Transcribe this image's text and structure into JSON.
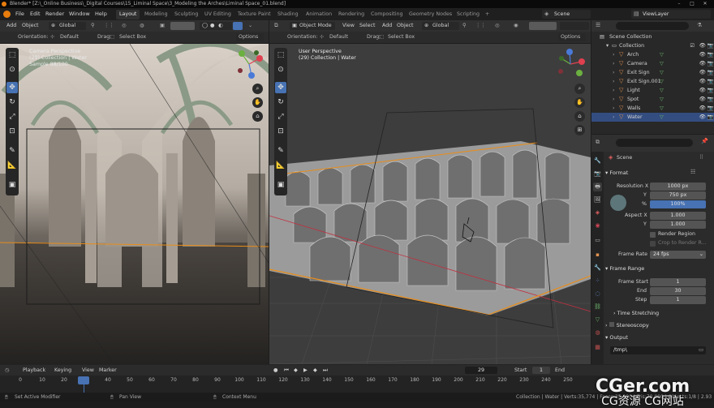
{
  "window": {
    "title": "Blender* [Z:\\_Online Business\\_Digital Courses\\15_Liminal Space\\3_Modeling the Arches\\Liminal Space_01.blend]"
  },
  "topbar": {
    "menus": [
      "File",
      "Edit",
      "Render",
      "Window",
      "Help"
    ],
    "workspaces": [
      "Layout",
      "Modeling",
      "Sculpting",
      "UV Editing",
      "Texture Paint",
      "Shading",
      "Animation",
      "Rendering",
      "Compositing",
      "Geometry Nodes",
      "Scripting"
    ],
    "add_tab": "+",
    "scene": "Scene",
    "view_layer": "ViewLayer"
  },
  "left_header": {
    "items": [
      "Add",
      "Object"
    ],
    "transform": "Global",
    "orientation_label": "Orientation:",
    "orientation_value": "Default",
    "drag_label": "Drag:",
    "drag_value": "Select Box",
    "options": "Options"
  },
  "right_header": {
    "mode": "Object Mode",
    "items": [
      "View",
      "Select",
      "Add",
      "Object"
    ],
    "transform": "Global",
    "orientation_label": "Orientation:",
    "orientation_value": "Default",
    "drag_label": "Drag:",
    "drag_value": "Select Box",
    "options": "Options"
  },
  "viewport_left": {
    "line1": "Camera Perspective",
    "line2": "(29) Collection | Water",
    "line3": "Sample 88/100"
  },
  "viewport_right": {
    "line1": "User Perspective",
    "line2": "(29) Collection | Water"
  },
  "outliner": {
    "root": "Scene Collection",
    "collection": "Collection",
    "items": [
      {
        "name": "Arch",
        "selected": false
      },
      {
        "name": "Camera",
        "selected": false
      },
      {
        "name": "Exit Sign",
        "selected": false
      },
      {
        "name": "Exit Sign.001",
        "selected": false
      },
      {
        "name": "Light",
        "selected": false
      },
      {
        "name": "Spot",
        "selected": false
      },
      {
        "name": "Walls",
        "selected": false
      },
      {
        "name": "Water",
        "selected": true
      }
    ]
  },
  "properties": {
    "scene": "Scene",
    "format": "Format",
    "resolution_x_label": "Resolution X",
    "resolution_x": "1000 px",
    "y_label": "Y",
    "resolution_y": "750 px",
    "percent_label": "%",
    "percent": "100%",
    "percent_fraction": 1.0,
    "aspect_x_label": "Aspect X",
    "aspect_x": "1.000",
    "aspect_y": "1.000",
    "render_region": "Render Region",
    "crop": "Crop to Render R...",
    "frame_rate_label": "Frame Rate",
    "frame_rate": "24 fps",
    "frame_range": "Frame Range",
    "frame_start_label": "Frame Start",
    "frame_start": "1",
    "end_label": "End",
    "frame_end": "30",
    "step_label": "Step",
    "step": "1",
    "time_stretching": "Time Stretching",
    "stereoscopy": "Stereoscopy",
    "output": "Output",
    "output_path": "/tmp\\"
  },
  "timeline": {
    "menus": [
      "Playback",
      "Keying",
      "View",
      "Marker"
    ],
    "current_frame": "29",
    "start_label": "Start",
    "start": "1",
    "end_label": "End",
    "end": "30",
    "ticks": [
      "0",
      "10",
      "20",
      "29",
      "40",
      "50",
      "60",
      "70",
      "80",
      "90",
      "100",
      "110",
      "120",
      "130",
      "140",
      "150",
      "160",
      "170",
      "180",
      "190",
      "200",
      "210",
      "220",
      "230",
      "240",
      "250"
    ]
  },
  "statusbar": {
    "left": "Set Active Modifier",
    "middle": "Pan View",
    "right": "Context Menu",
    "info": "Collection | Water | Verts:35,774 | Faces:35,000 | Tris:70,000 | Objects:1/8 | 2.93"
  },
  "watermark": {
    "line1": "CGer.com",
    "line2": "CG资源 CG网站"
  },
  "colors": {
    "accent": "#4772b3",
    "object_orange": "#e09050",
    "background": "#1d1d1d"
  }
}
